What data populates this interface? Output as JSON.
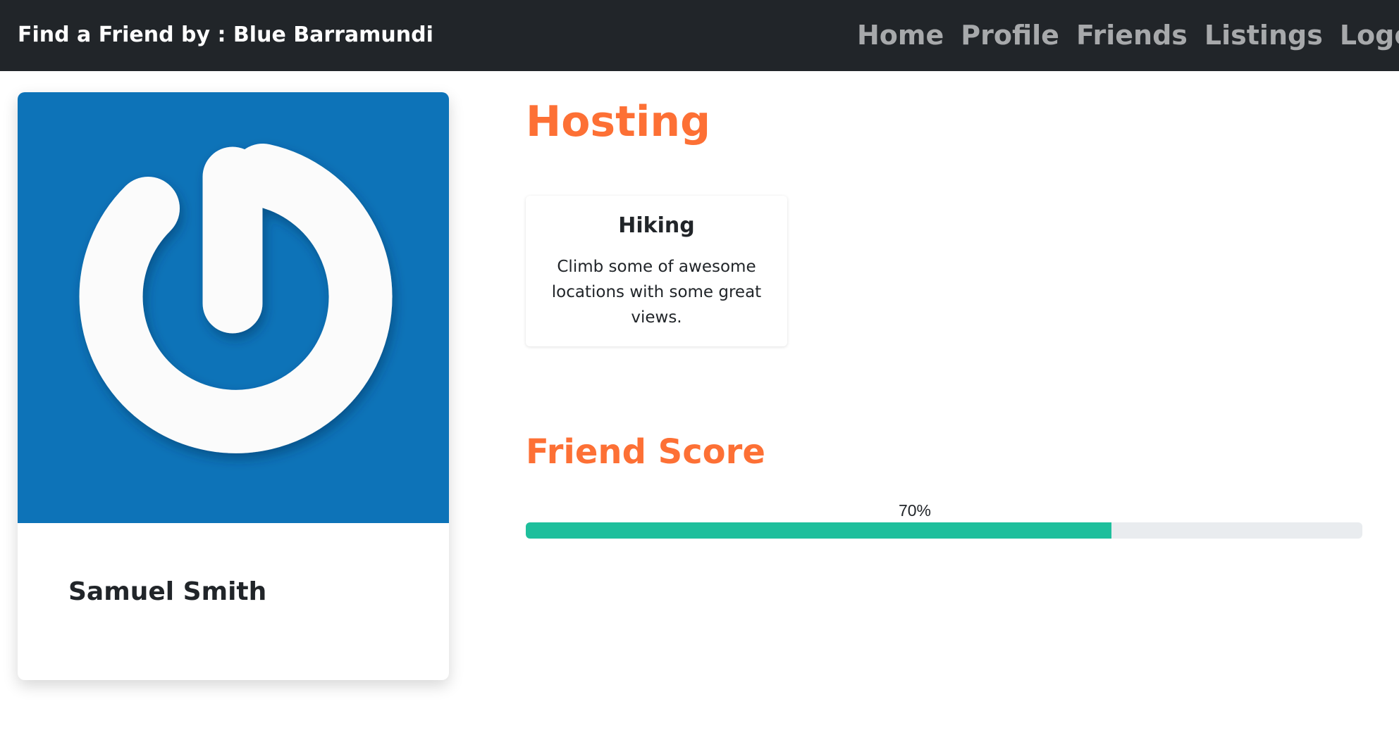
{
  "navbar": {
    "brand": "Find a Friend by : Blue Barramundi",
    "links": [
      "Home",
      "Profile",
      "Friends",
      "Listings",
      "Logout"
    ]
  },
  "profile": {
    "name": "Samuel Smith",
    "avatar_icon": "power-icon",
    "avatar_background": "#0d73b8"
  },
  "hosting": {
    "title": "Hosting",
    "listings": [
      {
        "title": "Hiking",
        "description": "Climb some of awesome locations with some great views."
      }
    ]
  },
  "friend_score": {
    "title": "Friend Score",
    "label": "70%",
    "value": 0.7,
    "fill_color": "#1ebf9c"
  },
  "colors": {
    "navbar_bg": "#212529",
    "accent": "#fd7035",
    "nav_link": "#a7a9ab"
  }
}
